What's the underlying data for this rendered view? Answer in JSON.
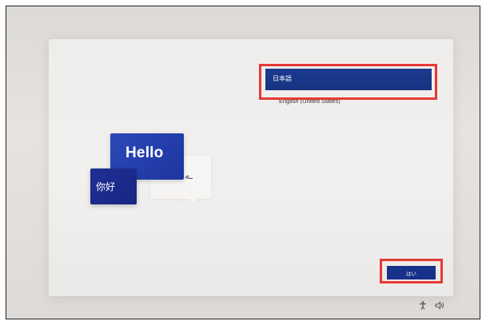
{
  "languages": {
    "selected": "日本語",
    "other": "English (United States)"
  },
  "illustration": {
    "hello": "Hello",
    "nihao": "你好",
    "arabic_glyph": "ـه"
  },
  "buttons": {
    "yes_label": "はい"
  },
  "tray": {
    "accessibility_icon": "accessibility-icon",
    "volume_icon": "volume-icon"
  },
  "colors": {
    "accent": "#163382",
    "highlight": "#e53935"
  }
}
